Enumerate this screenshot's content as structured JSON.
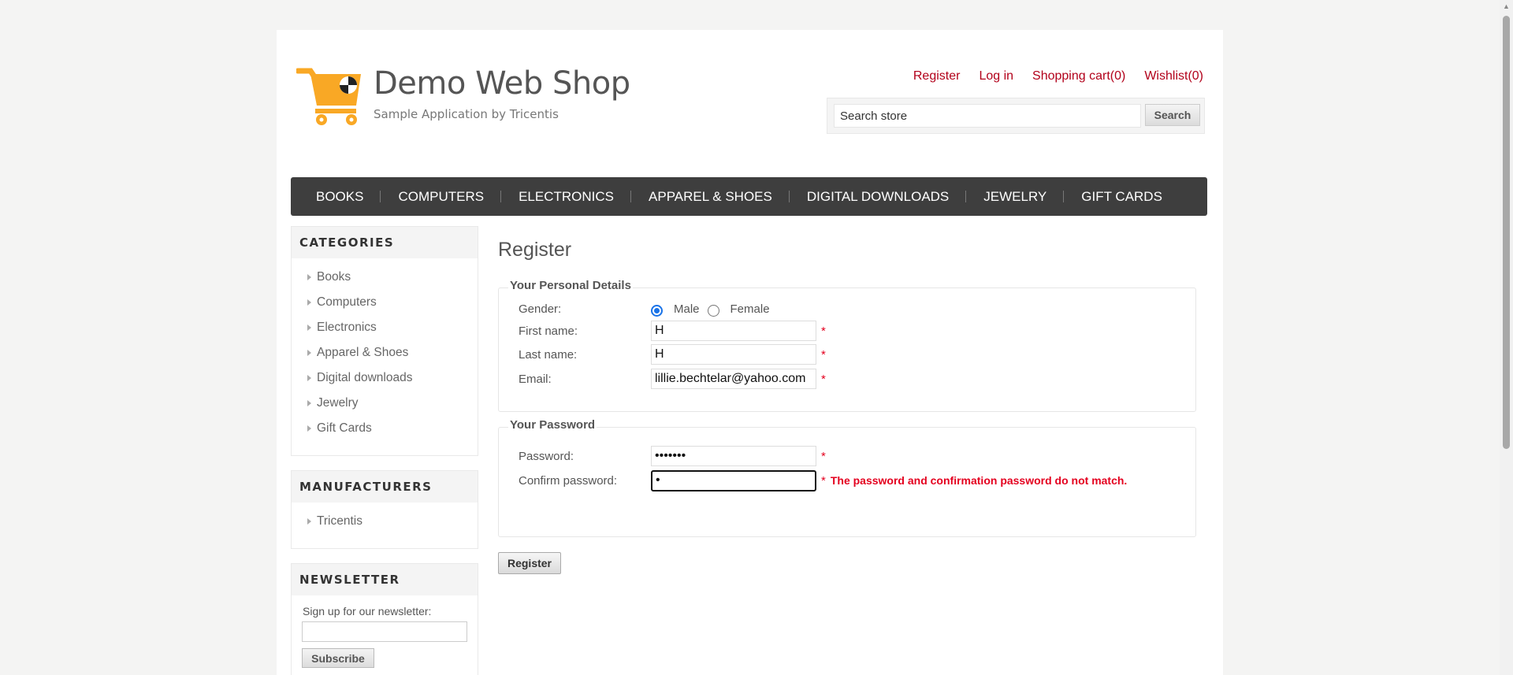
{
  "header": {
    "logo_title": "Demo Web Shop",
    "logo_subtitle": "Sample Application by Tricentis",
    "links": [
      "Register",
      "Log in",
      "Shopping cart(0)",
      "Wishlist(0)"
    ],
    "search_value": "Search store",
    "search_button": "Search"
  },
  "menu": [
    "BOOKS",
    "COMPUTERS",
    "ELECTRONICS",
    "APPAREL & SHOES",
    "DIGITAL DOWNLOADS",
    "JEWELRY",
    "GIFT CARDS"
  ],
  "categories": {
    "title": "CATEGORIES",
    "items": [
      "Books",
      "Computers",
      "Electronics",
      "Apparel & Shoes",
      "Digital downloads",
      "Jewelry",
      "Gift Cards"
    ]
  },
  "manufacturers": {
    "title": "MANUFACTURERS",
    "items": [
      "Tricentis"
    ]
  },
  "newsletter": {
    "title": "NEWSLETTER",
    "label": "Sign up for our newsletter:",
    "button": "Subscribe"
  },
  "form": {
    "title": "Register",
    "personal_legend": "Your Personal Details",
    "gender_label": "Gender:",
    "gender_male": "Male",
    "gender_female": "Female",
    "gender_selected": "Male",
    "first_name_label": "First name:",
    "first_name_value": "H",
    "last_name_label": "Last name:",
    "last_name_value": "H",
    "email_label": "Email:",
    "email_value": "lillie.bechtelar@yahoo.com",
    "password_legend": "Your Password",
    "password_label": "Password:",
    "password_value": "•••••••",
    "confirm_label": "Confirm password:",
    "confirm_value": "•",
    "required_mark": "*",
    "error_text": "The password and confirmation password do not match.",
    "register_button": "Register"
  },
  "colors": {
    "link": "#b2001a",
    "menu_bg": "#3e3e3e",
    "error": "#e4001f",
    "logo_cart": "#f9a825"
  }
}
